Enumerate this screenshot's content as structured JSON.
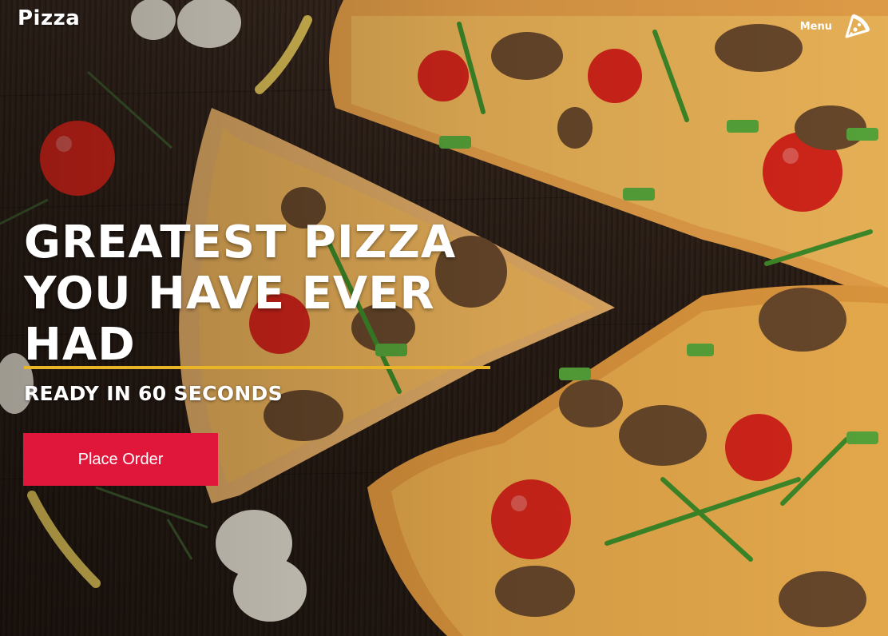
{
  "header": {
    "logo_text": "Pizza",
    "menu_label": "Menu",
    "menu_icon": "pizza-slice-icon"
  },
  "hero": {
    "headline_lines": [
      "GREATEST PIZZA",
      "YOU HAVE EVER",
      "HAD"
    ],
    "subheadline": "READY IN 60 SECONDS",
    "cta_label": "Place Order"
  },
  "colors": {
    "accent_line": "#e9b526",
    "cta_background": "#e0173a",
    "text": "#ffffff",
    "background_wood": "#2b1e16"
  }
}
